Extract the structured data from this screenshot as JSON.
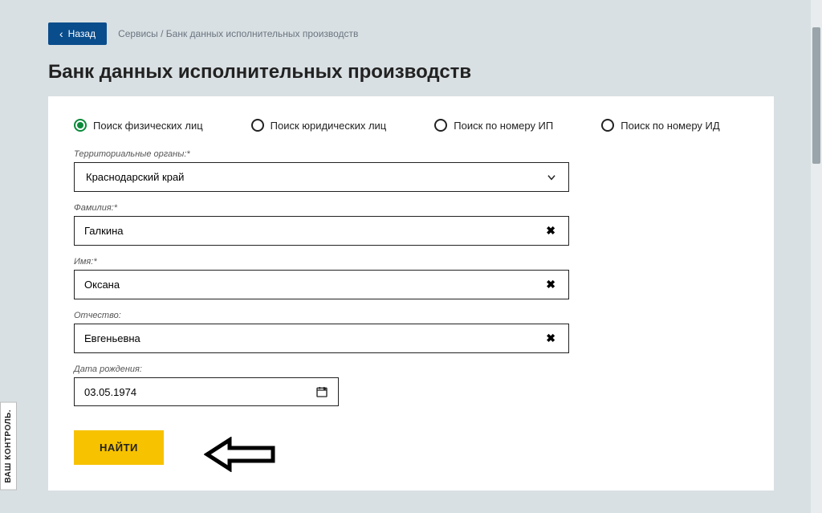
{
  "back": "Назад",
  "breadcrumb": "Сервисы  /  Банк данных исполнительных производств",
  "title": "Банк данных исполнительных производств",
  "radios": {
    "r1": "Поиск физических лиц",
    "r2": "Поиск юридических лиц",
    "r3": "Поиск по номеру ИП",
    "r4": "Поиск по номеру ИД"
  },
  "labels": {
    "territory": "Территориальные органы:*",
    "surname": "Фамилия:*",
    "name": "Имя:*",
    "patronymic": "Отчество:",
    "dob": "Дата рождения:"
  },
  "values": {
    "territory": "Краснодарский край",
    "surname": "Галкина",
    "name": "Оксана",
    "patronymic": "Евгеньевна",
    "dob": "03.05.1974"
  },
  "submit": "НАЙТИ",
  "side": "ВАШ КОНТРОЛЬ."
}
